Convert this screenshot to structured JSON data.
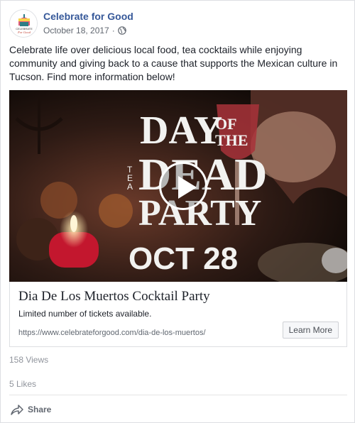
{
  "post": {
    "page_name": "Celebrate for Good",
    "date": "October 18, 2017",
    "separator": "·",
    "text": "Celebrate life over delicious local food, tea cocktails while enjoying community and giving back to a cause that supports the Mexican culture in Tucson. Find more information below!"
  },
  "avatar": {
    "logo_text": "CELEBRATE For Good"
  },
  "media": {
    "video_title_line1": "DAY OF THE",
    "video_title_line2": "DEAD",
    "video_title_line3": "TEA PARTY",
    "video_date": "OCT 28"
  },
  "link": {
    "title": "Dia De Los Muertos Cocktail Party",
    "description": "Limited number of tickets available.",
    "url": "https://www.celebrateforgood.com/dia-de-los-muertos/",
    "cta": "Learn More"
  },
  "stats": {
    "views": "158 Views",
    "likes": "5 Likes"
  },
  "actions": {
    "share": "Share"
  },
  "colors": {
    "page_link": "#365899",
    "meta": "#616770",
    "muted": "#90949c"
  }
}
